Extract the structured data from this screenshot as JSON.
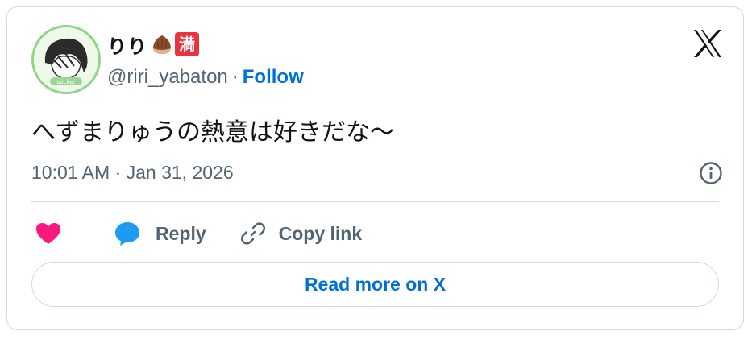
{
  "author": {
    "display_name": "りり",
    "emoji_1": "chestnut-emoji",
    "badge_text": "満",
    "handle": "@riri_yabaton",
    "separator": "·",
    "follow_label": "Follow",
    "avatar_icon": "avatar-illustration"
  },
  "tweet": {
    "text": "へずまりゅうの熱意は好きだな〜",
    "timestamp": "10:01 AM · Jan 31, 2026"
  },
  "actions": {
    "like_icon": "heart-icon",
    "reply_label": "Reply",
    "reply_icon": "speech-bubble-icon",
    "copy_label": "Copy link",
    "copy_icon": "link-icon"
  },
  "footer": {
    "read_more_label": "Read more on X"
  },
  "colors": {
    "accent": "#006fd6",
    "heart": "#f91880",
    "reply_bubble": "#1d9bf0",
    "muted": "#536471",
    "text": "#0f1419",
    "border": "#cfd9de",
    "badge": "#e8343f"
  }
}
